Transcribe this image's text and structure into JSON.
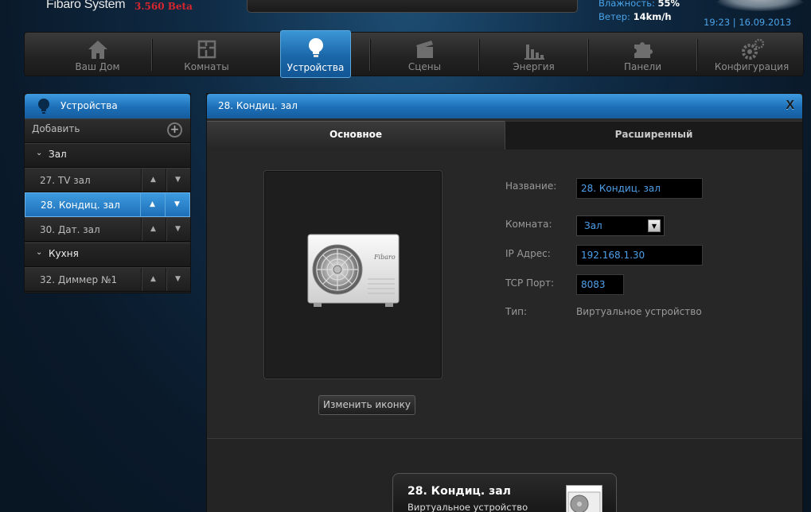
{
  "header": {
    "brand": "Fibaro System",
    "version": "3.560 Beta",
    "humidity_label": "Влажность:",
    "humidity_value": "55%",
    "wind_label": "Ветер:",
    "wind_value": "14km/h",
    "datetime": "19:23 | 16.09.2013"
  },
  "nav": {
    "items": [
      {
        "label": "Ваш Дом",
        "icon": "house-icon"
      },
      {
        "label": "Комнаты",
        "icon": "floorplan-icon"
      },
      {
        "label": "Устройства",
        "icon": "lightbulb-icon",
        "active": true
      },
      {
        "label": "Сцены",
        "icon": "clapperboard-icon"
      },
      {
        "label": "Энергия",
        "icon": "bar-chart-icon"
      },
      {
        "label": "Панели",
        "icon": "puzzle-icon"
      },
      {
        "label": "Конфигурация",
        "icon": "gears-icon"
      }
    ]
  },
  "sidebar": {
    "title": "Устройства",
    "add_label": "Добавить",
    "rows": [
      {
        "type": "group",
        "label": "Зал"
      },
      {
        "type": "device",
        "label": "27. TV зал"
      },
      {
        "type": "device",
        "label": "28. Кондиц. зал",
        "selected": true
      },
      {
        "type": "device",
        "label": "30. Дат. зал"
      },
      {
        "type": "group",
        "label": "Кухня"
      },
      {
        "type": "device",
        "label": "32. Диммер №1"
      }
    ]
  },
  "detail": {
    "title": "28. Кондиц. зал",
    "close_label": "X",
    "tabs": [
      "Основное",
      "Расширенный"
    ],
    "change_icon_label": "Изменить иконку",
    "fields": {
      "name_label": "Название:",
      "name_value": "28. Кондиц. зал",
      "room_label": "Комната:",
      "room_value": "Зал",
      "ip_label": "IP Адрес:",
      "ip_value": "192.168.1.30",
      "port_label": "TCP Порт:",
      "port_value": "8083",
      "type_label": "Тип:",
      "type_value": "Виртуальное устройство"
    },
    "device_brand": "Fibaro",
    "preview": {
      "title": "28. Кондиц. зал",
      "subtitle": "Виртуальное устройство"
    }
  },
  "colors": {
    "accent_blue": "#1d6fb7",
    "link_blue": "#4ea0ea",
    "version_red": "#d8262e"
  }
}
